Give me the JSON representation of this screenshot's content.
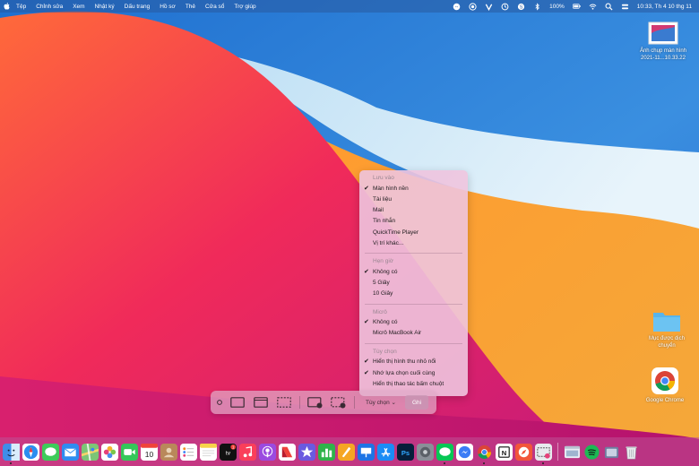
{
  "menubar": {
    "items": [
      "Tệp",
      "Chỉnh sửa",
      "Xem",
      "Nhật ký",
      "Dấu trang",
      "Hồ sơ",
      "Thẻ",
      "Cửa sổ",
      "Trợ giúp"
    ],
    "battery": "100%",
    "clock": "10:33, Th 4 10 thg 11"
  },
  "desktop": {
    "screenshot_file": {
      "line1": "Ảnh chụp màn hình",
      "line2": "2021-11...10.33.22"
    },
    "folder": {
      "line1": "Mục được dịch",
      "line2": "chuyển"
    },
    "chrome": {
      "label": "Google Chrome"
    }
  },
  "options_menu": {
    "sections": [
      {
        "header": "Lưu vào",
        "items": [
          {
            "label": "Màn hình nền",
            "checked": true
          },
          {
            "label": "Tài liệu",
            "checked": false
          },
          {
            "label": "Mail",
            "checked": false
          },
          {
            "label": "Tin nhắn",
            "checked": false
          },
          {
            "label": "QuickTime Player",
            "checked": false
          },
          {
            "label": "Vị trí khác...",
            "checked": false
          }
        ]
      },
      {
        "header": "Hẹn giờ",
        "items": [
          {
            "label": "Không có",
            "checked": true
          },
          {
            "label": "5 Giây",
            "checked": false
          },
          {
            "label": "10 Giây",
            "checked": false
          }
        ]
      },
      {
        "header": "Micrô",
        "items": [
          {
            "label": "Không có",
            "checked": true
          },
          {
            "label": "Micrô MacBook Air",
            "checked": false
          }
        ]
      },
      {
        "header": "Tùy chọn",
        "items": [
          {
            "label": "Hiển thị hình thu nhỏ nổi",
            "checked": true
          },
          {
            "label": "Nhớ lựa chọn cuối cùng",
            "checked": true
          },
          {
            "label": "Hiển thị thao tác bấm chuột",
            "checked": false
          }
        ]
      }
    ]
  },
  "toolbar": {
    "options_label": "Tùy chọn ⌄",
    "capture_label": "Ghi"
  },
  "dock": {
    "calendar_day": "10",
    "badge_count": "1"
  },
  "colors": {
    "menu_tint": "#285aa0",
    "menu_panel": "#eec4de",
    "toolbar_panel": "#e1aac8"
  }
}
